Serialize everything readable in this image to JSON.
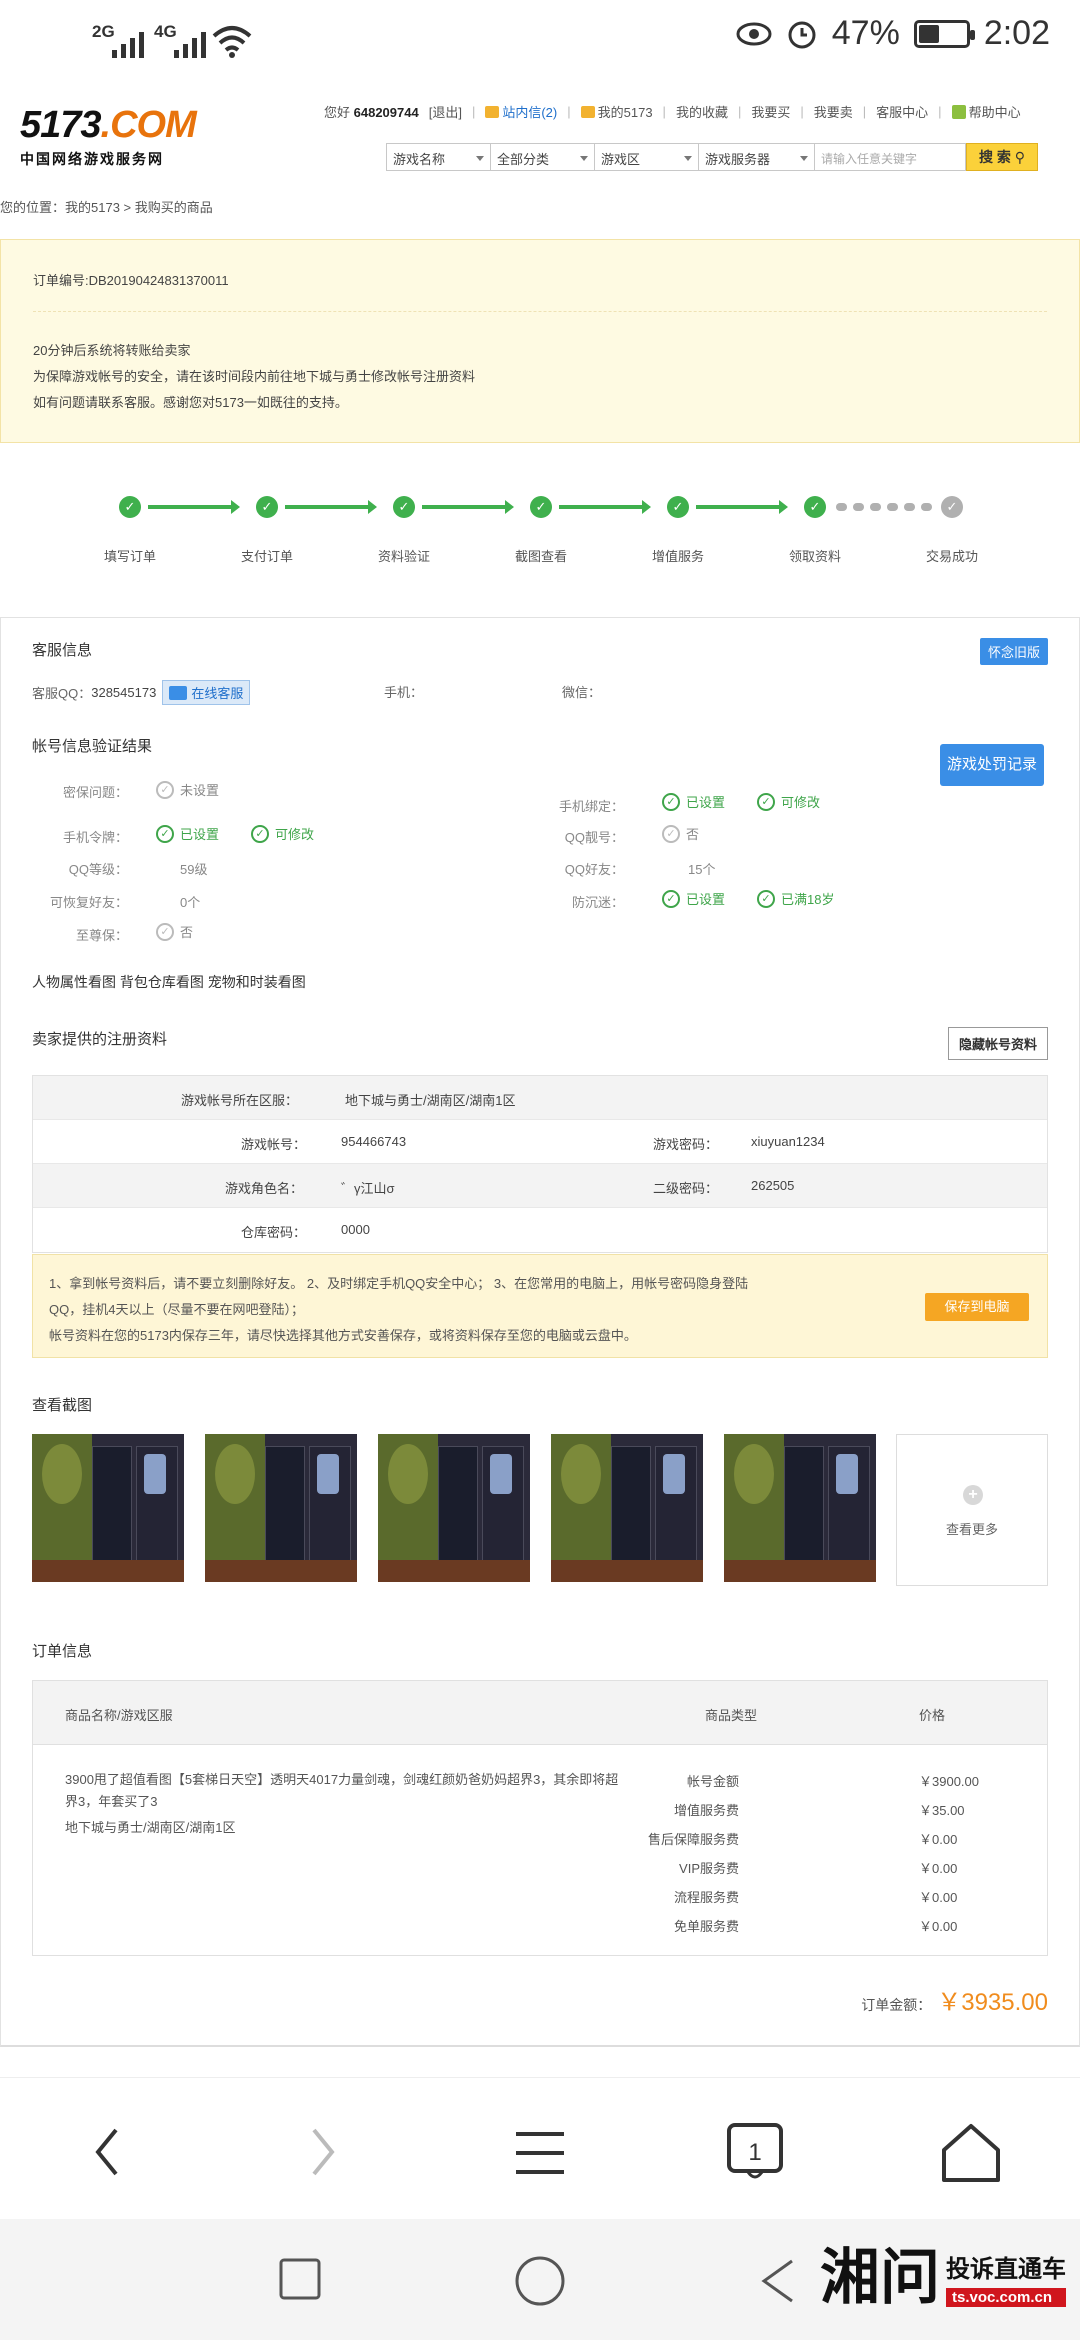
{
  "status": {
    "sig1": "2G",
    "sig2": "4G",
    "battery": "47%",
    "time": "2:02"
  },
  "logo": {
    "brand_a": "5173",
    "brand_b": ".COM",
    "subtitle": "中国网络游戏服务网"
  },
  "top_nav": {
    "greeting": "您好",
    "user": "648209744",
    "logout": "[退出]",
    "mail": "站内信(2)",
    "my5173": "我的5173",
    "fav": "我的收藏",
    "buy": "我要买",
    "sell": "我要卖",
    "service": "客服中心",
    "help": "帮助中心"
  },
  "search": {
    "game": "游戏名称",
    "category": "全部分类",
    "zone": "游戏区",
    "server": "游戏服务器",
    "placeholder": "请输入任意关键字",
    "button": "搜 索"
  },
  "breadcrumb": "您的位置：我的5173 > 我购买的商品",
  "order_notice": {
    "order_no": "订单编号:DB20190424831370011",
    "line1": "20分钟后系统将转账给卖家",
    "line2": "为保障游戏帐号的安全，请在该时间段内前往地下城与勇士修改帐号注册资料",
    "line3": "如有问题请联系客服。感谢您对5173一如既往的支持。"
  },
  "steps": [
    "填写订单",
    "支付订单",
    "资料验证",
    "截图查看",
    "增值服务",
    "领取资料",
    "交易成功"
  ],
  "cs": {
    "title": "客服信息",
    "old_btn": "怀念旧版",
    "qq_label": "客服QQ：",
    "qq": "328545173",
    "online_btn": "在线客服",
    "phone_label": "手机：",
    "wechat_label": "微信："
  },
  "verify": {
    "title": "帐号信息验证结果",
    "penalty_btn": "游戏处罚记录",
    "pwd_q_label": "密保问题：",
    "pwd_q": "未设置",
    "phone_bind_label": "手机绑定：",
    "phone_bind_a": "已设置",
    "phone_bind_b": "可修改",
    "token_label": "手机令牌：",
    "token_a": "已设置",
    "token_b": "可修改",
    "qq_prettyno_label": "QQ靓号：",
    "qq_prettyno": "否",
    "qq_level_label": "QQ等级：",
    "qq_level": "59级",
    "qq_friends_label": "QQ好友：",
    "qq_friends": "15个",
    "recover_label": "可恢复好友：",
    "recover": "0个",
    "anti_label": "防沉迷：",
    "anti_a": "已设置",
    "anti_b": "已满18岁",
    "vip_label": "至尊保：",
    "vip": "否"
  },
  "views": "人物属性看图 背包仓库看图 宠物和时装看图",
  "reg": {
    "title": "卖家提供的注册资料",
    "hide_btn": "隐藏帐号资料",
    "server_label": "游戏帐号所在区服：",
    "server": "地下城与勇士/湖南区/湖南1区",
    "account_label": "游戏帐号：",
    "account": "954466743",
    "pwd_label": "游戏密码：",
    "pwd": "xiuyuan1234",
    "role_label": "游戏角色名：",
    "role": "゛γ江山σ",
    "pwd2_label": "二级密码：",
    "pwd2": "262505",
    "store_label": "仓库密码：",
    "store": "0000"
  },
  "tip": {
    "line1": "1、拿到帐号资料后，请不要立刻删除好友。 2、及时绑定手机QQ安全中心； 3、在您常用的电脑上，用帐号密码隐身登陆",
    "line2": "QQ，挂机4天以上（尽量不要在网吧登陆）；",
    "line3": "帐号资料在您的5173内保存三年，请尽快选择其他方式安善保存，或将资料保存至您的电脑或云盘中。",
    "save_btn": "保存到电脑"
  },
  "screens": {
    "title": "查看截图",
    "more": "查看更多"
  },
  "order": {
    "title": "订单信息",
    "col_name": "商品名称/游戏区服",
    "col_type": "商品类型",
    "col_price": "价格",
    "desc_a": "3900甩了超值看图【5套梯日天空】透明天4017力量剑魂，剑魂红颜奶爸奶妈超界3，其余即将超",
    "desc_b": "界3，年套买了3",
    "desc_server": "地下城与勇士/湖南区/湖南1区",
    "fees": [
      {
        "label": "帐号金额",
        "price": "￥3900.00"
      },
      {
        "label": "增值服务费",
        "price": "￥35.00"
      },
      {
        "label": "售后保障服务费",
        "price": "￥0.00"
      },
      {
        "label": "VIP服务费",
        "price": "￥0.00"
      },
      {
        "label": "流程服务费",
        "price": "￥0.00"
      },
      {
        "label": "免单服务费",
        "price": "￥0.00"
      }
    ],
    "total_label": "订单金额：",
    "total": "￥3935.00"
  },
  "watermark": {
    "char": "湘问",
    "top": "投诉直通车",
    "url": "ts.voc.com.cn"
  },
  "colors": {
    "accent": "#3a8ee6",
    "success": "#3fb04d",
    "orange": "#f5a623",
    "notice_bg": "#fefae2"
  }
}
